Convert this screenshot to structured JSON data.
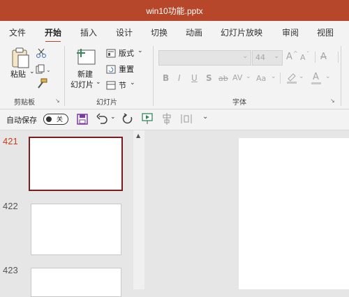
{
  "window": {
    "title": "win10功能.pptx"
  },
  "ribbon_tabs": [
    "文件",
    "开始",
    "插入",
    "设计",
    "切换",
    "动画",
    "幻灯片放映",
    "审阅",
    "视图"
  ],
  "active_tab": "开始",
  "clipboard": {
    "paste": "粘贴",
    "group": "剪贴板"
  },
  "slides_group": {
    "new_slide_line1": "新建",
    "new_slide_line2": "幻灯片",
    "layout": "版式",
    "reset": "重置",
    "section": "节",
    "group": "幻灯片"
  },
  "font_group": {
    "size": "44",
    "grow": "A",
    "shrink": "A",
    "clear": "A",
    "bold": "B",
    "italic": "I",
    "underline": "U",
    "shadow": "S",
    "strike": "ab",
    "spacing": "AV",
    "case": "Aa",
    "color": "A",
    "group": "字体"
  },
  "qat": {
    "autosave_label": "自动保存",
    "toggle_state": "关"
  },
  "slides": [
    {
      "number": "421",
      "selected": true
    },
    {
      "number": "422",
      "selected": false
    },
    {
      "number": "423",
      "selected": false
    }
  ],
  "colors": {
    "accent": "#b7472a",
    "selected_border": "#7b1c1c",
    "selected_number": "#c43e1c"
  }
}
